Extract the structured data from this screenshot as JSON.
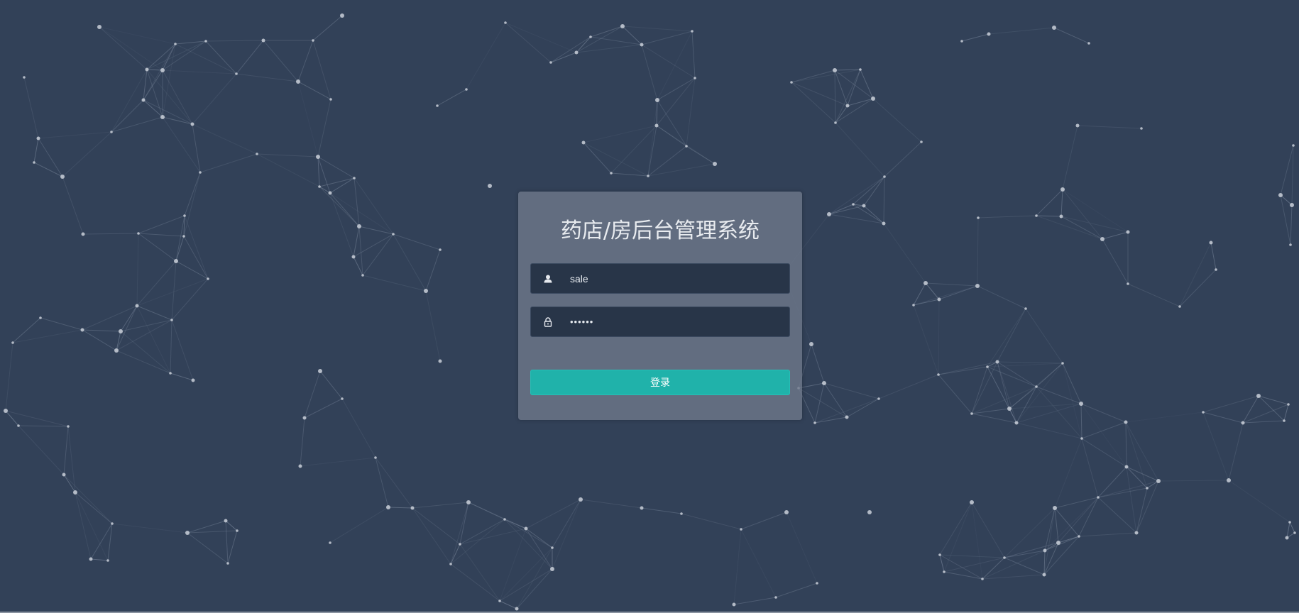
{
  "login": {
    "title": "药店/房后台管理系统",
    "username": {
      "value": "sale",
      "icon": "user-icon"
    },
    "password": {
      "value": "••••••",
      "icon": "lock-icon"
    },
    "submit_label": "登录"
  },
  "colors": {
    "background": "#324158",
    "panel": "#6b7689",
    "input": "#283548",
    "button": "#20b2aa",
    "title_text": "#e8ebef"
  }
}
